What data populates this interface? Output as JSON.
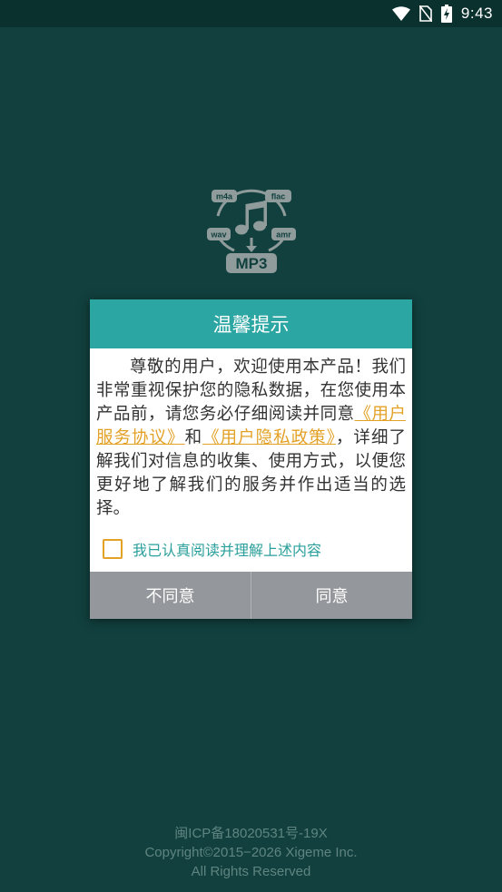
{
  "status_bar": {
    "time": "9:43",
    "icons": [
      "wifi-icon",
      "no-sim-icon",
      "battery-charging-icon"
    ]
  },
  "logo": {
    "formats": [
      "m4a",
      "flac",
      "wav",
      "amr"
    ],
    "badge": "MP3",
    "icon": "music-note-icon"
  },
  "dialog": {
    "title": "温馨提示",
    "body_text_1": "尊敬的用户，欢迎使用本产品！我们非常重视保护您的隐私数据，在您使用本产品前，请您务必仔细阅读并同意",
    "service_agreement_link": "《用户服务协议》",
    "conjunction": "和",
    "privacy_policy_link": "《用户隐私政策》",
    "body_text_2": "，详细了解我们对信息的收集、使用方式，以便您更好地了解我们的服务并作出适当的选择。",
    "consent_checkbox_label": "我已认真阅读并理解上述内容",
    "consent_checked": false,
    "disagree_label": "不同意",
    "agree_label": "同意"
  },
  "footer": {
    "icp": "闽ICP备18020531号-19X",
    "copyright": "Copyright©2015−2026 Xigeme Inc.",
    "rights": "All Rights Reserved"
  },
  "colors": {
    "background": "#11403e",
    "status_bar": "#0b312f",
    "accent": "#2ba6a3",
    "link": "#e3a126",
    "button_bg": "#94979b"
  }
}
